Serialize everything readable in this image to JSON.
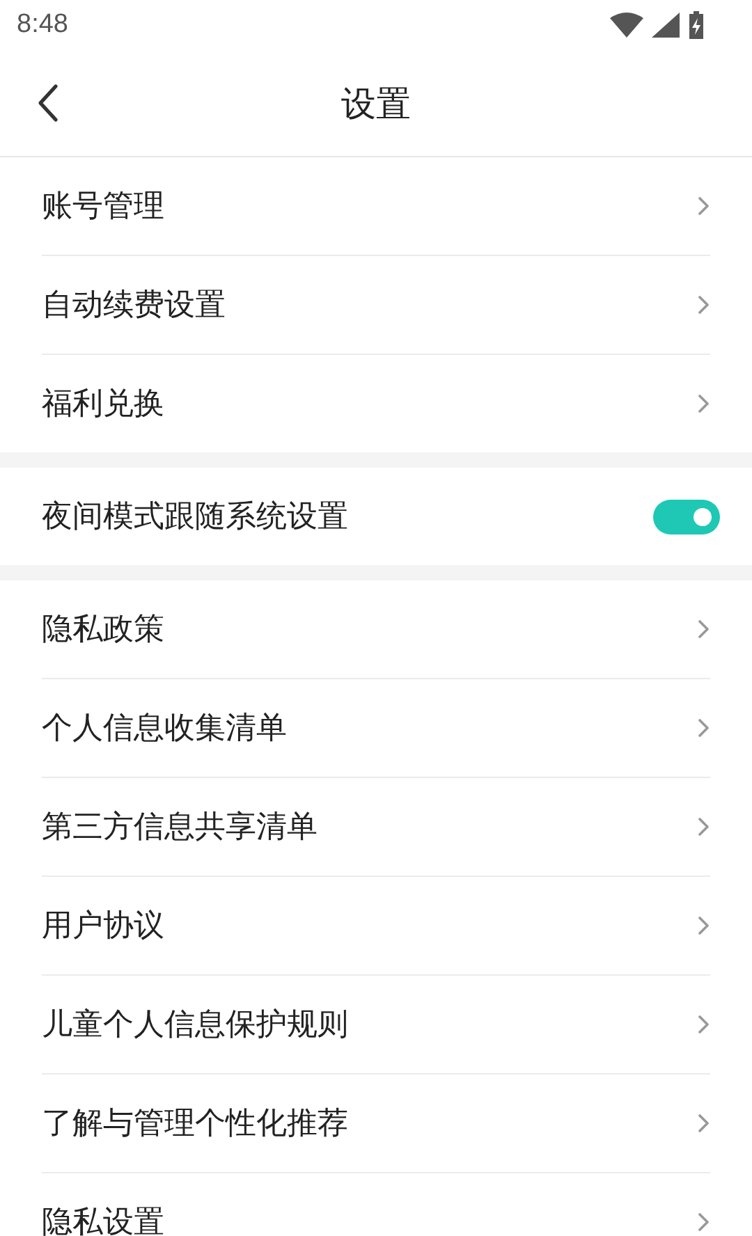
{
  "status_bar": {
    "time": "8:48"
  },
  "header": {
    "title": "设置"
  },
  "sections": [
    {
      "items": [
        {
          "kind": "link",
          "label": "账号管理"
        },
        {
          "kind": "link",
          "label": "自动续费设置"
        },
        {
          "kind": "link",
          "label": "福利兑换"
        }
      ]
    },
    {
      "items": [
        {
          "kind": "toggle",
          "label": "夜间模式跟随系统设置",
          "on": true
        }
      ]
    },
    {
      "items": [
        {
          "kind": "link",
          "label": "隐私政策"
        },
        {
          "kind": "link",
          "label": "个人信息收集清单"
        },
        {
          "kind": "link",
          "label": "第三方信息共享清单"
        },
        {
          "kind": "link",
          "label": "用户协议"
        },
        {
          "kind": "link",
          "label": "儿童个人信息保护规则"
        },
        {
          "kind": "link",
          "label": "了解与管理个性化推荐"
        },
        {
          "kind": "link",
          "label": "隐私设置"
        }
      ]
    }
  ]
}
